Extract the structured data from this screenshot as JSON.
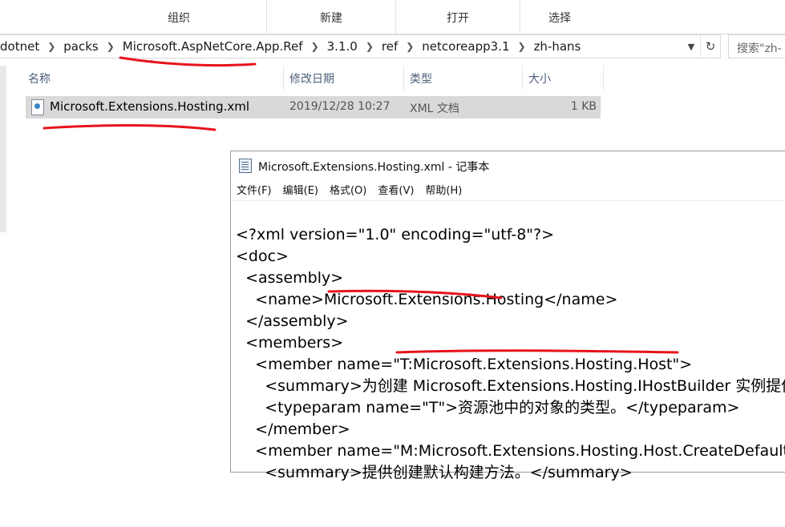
{
  "ribbon": {
    "groups": [
      "组织",
      "新建",
      "打开",
      "选择"
    ]
  },
  "address": {
    "crumbs": [
      "dotnet",
      "packs",
      "Microsoft.AspNetCore.App.Ref",
      "3.1.0",
      "ref",
      "netcoreapp3.1",
      "zh-hans"
    ],
    "dropdown_icon": "chevron-down-icon",
    "refresh_icon": "refresh-icon"
  },
  "search": {
    "placeholder": "搜索\"zh-"
  },
  "file_list": {
    "columns": [
      "名称",
      "修改日期",
      "类型",
      "大小"
    ],
    "rows": [
      {
        "name": "Microsoft.Extensions.Hosting.xml",
        "modified": "2019/12/28 10:27",
        "type": "XML 文档",
        "size": "1 KB"
      }
    ]
  },
  "notepad": {
    "title": "Microsoft.Extensions.Hosting.xml - 记事本",
    "menu": [
      "文件(F)",
      "编辑(E)",
      "格式(O)",
      "查看(V)",
      "帮助(H)"
    ],
    "lines": [
      "<?xml version=\"1.0\" encoding=\"utf-8\"?>",
      "<doc>",
      "  <assembly>",
      "    <name>Microsoft.Extensions.Hosting</name>",
      "  </assembly>",
      "  <members>",
      "    <member name=\"T:Microsoft.Extensions.Hosting.Host\">",
      "      <summary>为创建 Microsoft.Extensions.Hosting.IHostBuilder 实例提供",
      "      <typeparam name=\"T\">资源池中的对象的类型。</typeparam>",
      "    </member>",
      "    <member name=\"M:Microsoft.Extensions.Hosting.Host.CreateDefault",
      "      <summary>提供创建默认构建方法。</summary>"
    ]
  },
  "colors": {
    "annotation": "#e8131b",
    "selection": "#d9d9d9"
  }
}
